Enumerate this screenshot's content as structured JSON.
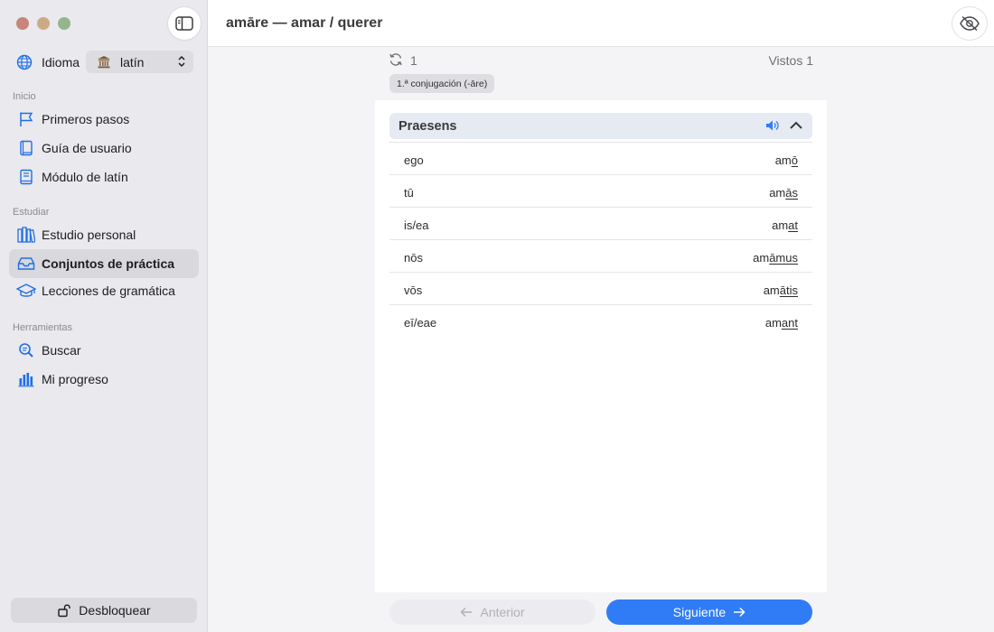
{
  "window": {
    "title": "amāre — amar / querer"
  },
  "sidebar": {
    "language_label": "Idioma",
    "language_value": "latín",
    "sections": [
      {
        "title": "Inicio",
        "items": [
          {
            "label": "Primeros pasos",
            "icon": "flag-icon"
          },
          {
            "label": "Guía de usuario",
            "icon": "book-icon"
          },
          {
            "label": "Módulo de latín",
            "icon": "module-book-icon"
          }
        ]
      },
      {
        "title": "Estudiar",
        "items": [
          {
            "label": "Estudio personal",
            "icon": "books-icon"
          },
          {
            "label": "Conjuntos de práctica",
            "icon": "tray-icon",
            "active": true
          },
          {
            "label": "Lecciones de gramática",
            "icon": "graduation-cap-icon"
          }
        ]
      },
      {
        "title": "Herramientas",
        "items": [
          {
            "label": "Buscar",
            "icon": "search-icon"
          },
          {
            "label": "Mi progreso",
            "icon": "bar-chart-icon"
          }
        ]
      }
    ],
    "unlock_label": "Desbloquear"
  },
  "meta": {
    "count": "1",
    "seen": "Vistos 1",
    "tag": "1.ª conjugación (-āre)"
  },
  "tense": {
    "name": "Praesens",
    "rows": [
      {
        "pronoun": "ego",
        "stem": "am",
        "ending": "ō"
      },
      {
        "pronoun": "tū",
        "stem": "am",
        "ending": "ās"
      },
      {
        "pronoun": "is/ea",
        "stem": "am",
        "ending": "at"
      },
      {
        "pronoun": "nōs",
        "stem": "am",
        "ending": "āmus"
      },
      {
        "pronoun": "vōs",
        "stem": "am",
        "ending": "ātis"
      },
      {
        "pronoun": "eī/eae",
        "stem": "am",
        "ending": "ant"
      }
    ]
  },
  "nav_buttons": {
    "prev": "Anterior",
    "next": "Siguiente"
  },
  "colors": {
    "accent": "#2f7cf6",
    "active_item_bg": "#d8d8dd",
    "tense_header_bg": "#e6eaf3"
  }
}
